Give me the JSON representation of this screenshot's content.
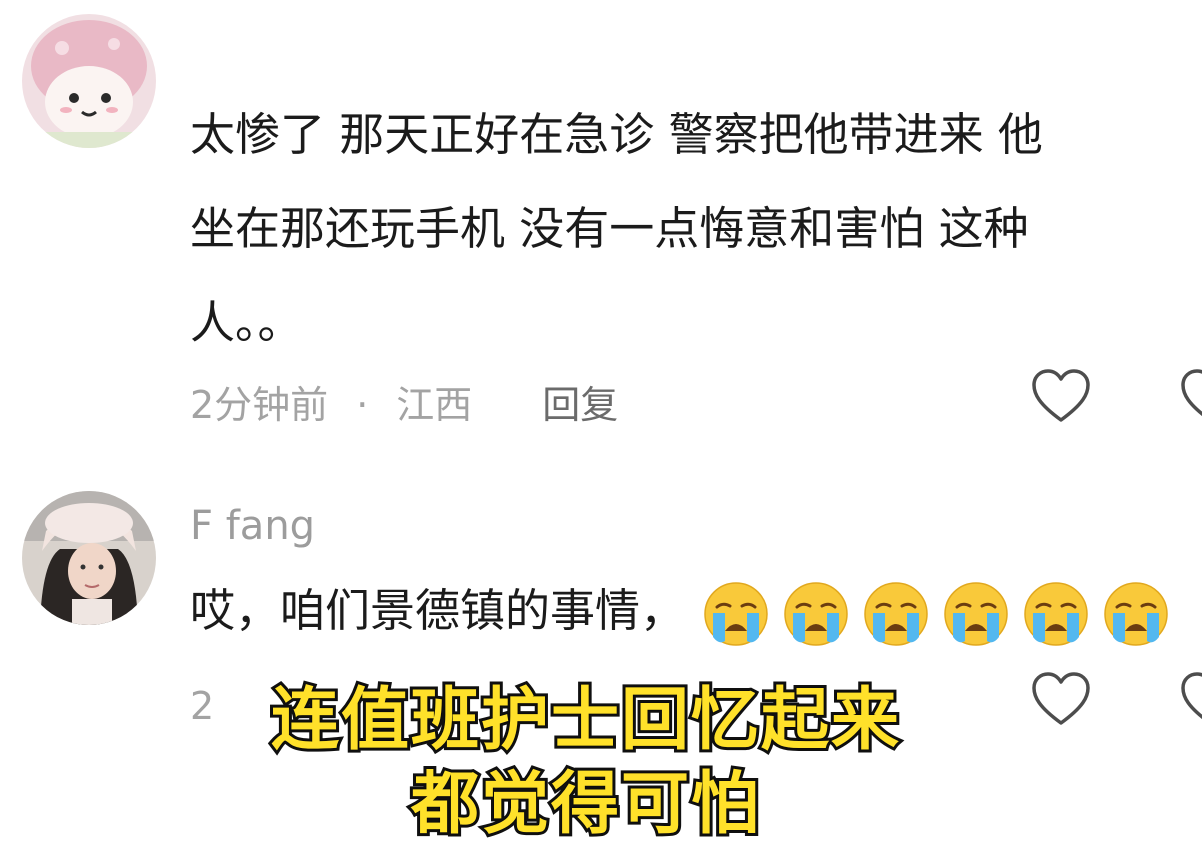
{
  "comments": [
    {
      "text_lines": [
        "太惨了 那天正好在急诊 警察把他带进来 他",
        "坐在那还玩手机 没有一点悔意和害怕 这种",
        "人。。"
      ],
      "time": "2分钟前",
      "separator": "·",
      "region": "江西",
      "reply_label": "回复",
      "avatar_icon": "cartoon-mushroom-avatar-icon"
    },
    {
      "username": "F fang",
      "text": "哎，咱们景德镇的事情，",
      "emoji": "loudly-crying-face-icon",
      "emoji_count": 6,
      "time": "2",
      "avatar_icon": "user-photo-avatar-icon"
    }
  ],
  "subtitle": {
    "line1": "连值班护士回忆起来",
    "line2": "都觉得可怕"
  },
  "colors": {
    "subtitle_fill": "#ffe12a",
    "subtitle_stroke": "#111111",
    "meta_gray": "#a3a3a3",
    "text": "#1b1b1b"
  }
}
